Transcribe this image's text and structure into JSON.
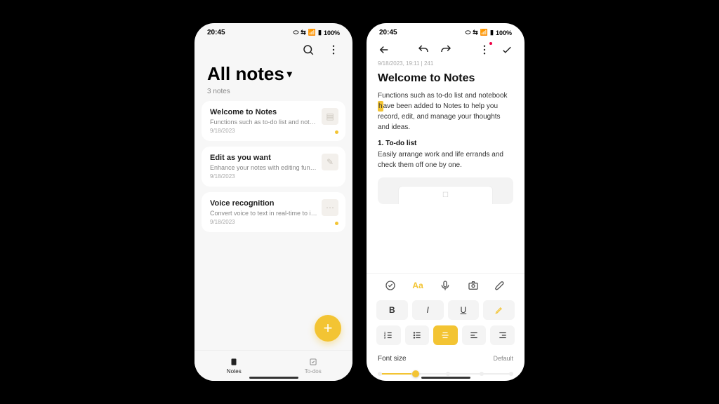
{
  "status": {
    "time": "20:45",
    "battery": "100%",
    "signal_text": "⬡ ⇆ ▮▮▮▮"
  },
  "list_screen": {
    "title": "All notes",
    "count_text": "3 notes",
    "notes": [
      {
        "title": "Welcome to Notes",
        "preview": "Functions such as to-do list and noteboo...",
        "date": "9/18/2023"
      },
      {
        "title": "Edit as you want",
        "preview": "Enhance your notes with editing function...",
        "date": "9/18/2023"
      },
      {
        "title": "Voice recognition",
        "preview": "Convert voice to text in real-time to impr...",
        "date": "9/18/2023"
      }
    ],
    "nav": {
      "notes": "Notes",
      "todos": "To-dos"
    },
    "fab_label": "+"
  },
  "editor_screen": {
    "meta": "9/18/2023, 19:11  |  241",
    "title": "Welcome to Notes",
    "intro_pre": "Functions such as to-do list and notebook ",
    "intro_hl": "h",
    "intro_post": "ave been added to Notes to help you record, edit, and manage your thoughts and ideas.",
    "section1_title": "1. To-do list",
    "section1_text": "Easily arrange work and life errands and check them off one by one.",
    "format": {
      "bold": "B",
      "italic": "I",
      "underline": "U",
      "font_size_label": "Font size",
      "font_size_value": "Default"
    },
    "tool_tabs": {
      "checklist": "checklist-icon",
      "text": "Aa",
      "voice": "voice-icon",
      "camera": "camera-icon",
      "draw": "draw-icon"
    }
  },
  "colors": {
    "accent": "#f3c433"
  }
}
